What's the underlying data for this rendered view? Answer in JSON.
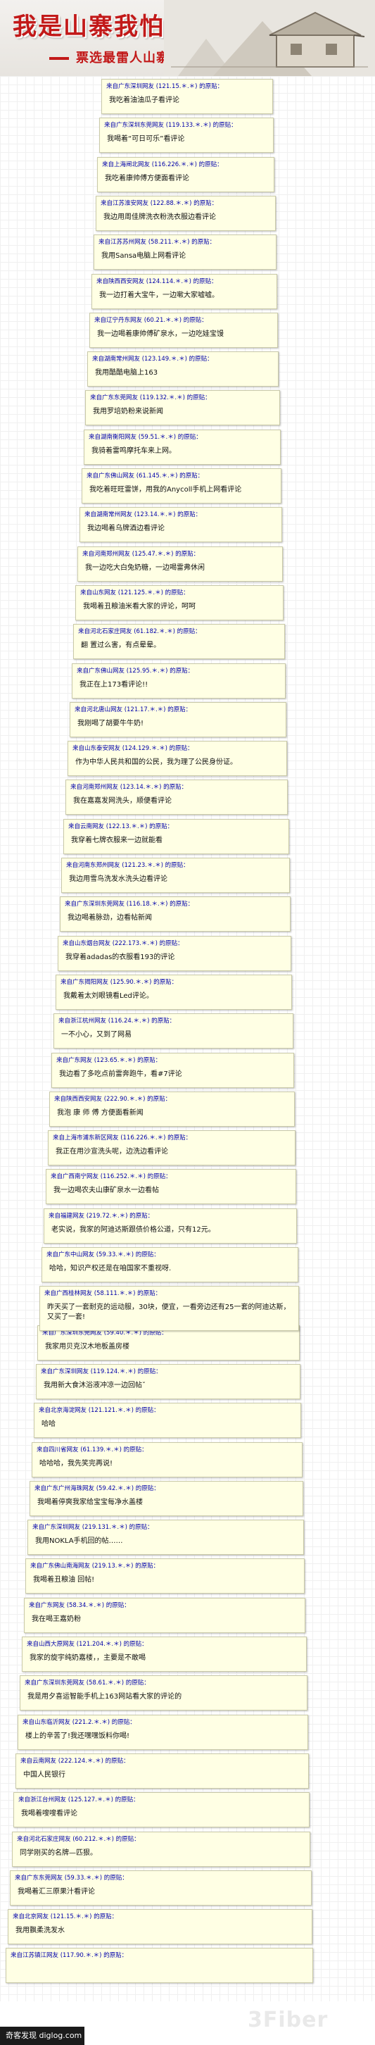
{
  "banner": {
    "title": "我是山寨我怕谁",
    "subtitle": "票选最雷人山寨作品"
  },
  "footer": {
    "site": "奇客发现 diglog.com",
    "watermark": "3Fiber"
  },
  "posts": [
    {
      "header": "来自广东深圳网友 (121.15.＊.＊) 的原贴：",
      "text": "我吃着油油瓜子看评论"
    },
    {
      "header": "来自广东深圳东莞网友 (119.133.＊.＊) 的原贴：",
      "text": "我喝着“可日可乐”看评论"
    },
    {
      "header": "来自上海闸北网友 (116.226.＊.＊) 的原贴：",
      "text": "我吃着康帅傅方便面看评论"
    },
    {
      "header": "来自江苏淮安网友 (122.88.＊.＊) 的原贴：",
      "text": "我边用周佳牌洗衣粉洗衣服边看评论"
    },
    {
      "header": "来自江苏苏州网友 (58.211.＊.＊) 的原贴：",
      "text": "我用Sansa电脑上网看评论"
    },
    {
      "header": "来自陕西西安网友 (124.114.＊.＊) 的原贴：",
      "text": "我一边打着大宝牛，一边嗽大家嘘嘘。"
    },
    {
      "header": "来自辽宁丹东网友 (60.21.＊.＊) 的原贴：",
      "text": "我一边喝着康帅傅矿泉水，一边吃娃宝馒"
    },
    {
      "header": "来自湖南常州网友 (123.149.＊.＊) 的原贴：",
      "text": "我用酷酷电脑上163"
    },
    {
      "header": "来自广东东莞网友 (119.132.＊.＊) 的原贴：",
      "text": "我用罗培奶粉来说新闻"
    },
    {
      "header": "来自湖南衡阳网友 (59.51.＊.＊) 的原贴：",
      "text": "我骑着雷鸣摩托车来上网。"
    },
    {
      "header": "来自广东佛山网友 (61.145.＊.＊) 的原贴：",
      "text": "我吃着旺旺雷饼，用我的Anycoll手机上网看评论"
    },
    {
      "header": "来自湖南常州网友 (123.14.＊.＊) 的原贴：",
      "text": "我边喝着乌牌酒边看评论"
    },
    {
      "header": "来自河南郑州网友 (125.47.＊.＊) 的原贴：",
      "text": "我一边吃大白兔奶糖，一边喝雷弗休闲"
    },
    {
      "header": "来自山东网友 (121.125.＊.＊) 的原贴：",
      "text": "我喝着丑粮油米看大家的评论，呵呵"
    },
    {
      "header": "来自河北石家庄网友 (61.182.＊.＊) 的原贴：",
      "text": "翻 置过么害，有点晕晕。"
    },
    {
      "header": "来自广东佛山网友 (125.95.＊.＊) 的原贴：",
      "text": "我正在上173看评论!!"
    },
    {
      "header": "来自河北唐山网友 (121.17.＊.＊) 的原贴：",
      "text": "我刚喝了胡要牛牛奶!"
    },
    {
      "header": "来自山东泰安网友 (124.129.＊.＊) 的原贴：",
      "text": "作为中华人民共和国的公民，我为理了公民身份证。"
    },
    {
      "header": "来自河南郑州网友 (123.14.＊.＊) 的原贴：",
      "text": "我在嘉嘉发网洗头，顺便看评论"
    },
    {
      "header": "来自云南网友 (122.13.＊.＊) 的原贴：",
      "text": "我穿着七牌衣服来一边就能看"
    },
    {
      "header": "来自河南东郑州网友 (121.23.＊.＊) 的原贴：",
      "text": "我边用雪鸟洗发水洗头边看评论"
    },
    {
      "header": "来自广东深圳东莞网友 (116.18.＊.＊) 的原贴：",
      "text": "我边喝着脉劲，边看帖新闻"
    },
    {
      "header": "来自山东烟台网友 (222.173.＊.＊) 的原贴：",
      "text": "我穿着adadas的衣服看193的评论"
    },
    {
      "header": "来自广东揭阳网友 (125.90.＊.＊) 的原贴：",
      "text": "我戴着太刘眼镜看Led评论。"
    },
    {
      "header": "来自浙江杭州网友 (116.24.＊.＊) 的原贴：",
      "text": "一不小心，又到了网易"
    },
    {
      "header": "来自广东网友 (123.65.＊.＊) 的原贴：",
      "text": "我边看了多吃点前雷奔跑牛，看#7评论"
    },
    {
      "header": "来自陕西西安网友 (222.90.＊.＊) 的原贴：",
      "text": "我泡 康 师 傅 方便面看新闻"
    },
    {
      "header": "来自上海市浦东新区网友 (116.226.＊.＊) 的原贴：",
      "text": "我正在用沙宣洗头呢，边洗边看评论"
    },
    {
      "header": "来自广西南宁网友 (116.252.＊.＊) 的原贴：",
      "text": "我一边喝农夫山康矿泉水一边看帖"
    },
    {
      "header": "来自福建网友 (219.72.＊.＊) 的原贴：",
      "text": "老实说，我家的阿迪达斯跟债价格公道，只有12元。"
    },
    {
      "header": "来自广东中山网友 (59.33.＊.＊) 的原贴：",
      "text": "哈哈，知识产权还是在咱国家不重视呀."
    },
    {
      "header": "来自广西桂林网友 (58.111.＊.＊) 的原贴：",
      "text": "昨天买了一套耐克的运动服，30块，便宜，一看旁边还有25一套的阿迪达斯，又买了一套!"
    },
    {
      "header": "来自广东深圳东莞网友 (59.40.＊.＊) 的原贴：",
      "text": "我家用贝克汉木地板盖房楼"
    },
    {
      "header": "来自广东深圳网友 (119.124.＊.＊) 的原贴：",
      "text": "我用新大食沐浴液冲凉一边回帖ˇ"
    },
    {
      "header": "来自北京海淀网友 (121.121.＊.＊) 的原贴：",
      "text": "哈哈"
    },
    {
      "header": "来自四川省网友 (61.139.＊.＊) 的原贴：",
      "text": "哈哈哈，我先笑完再说!"
    },
    {
      "header": "来自广东广州海珠网友 (59.42.＊.＊) 的原贴：",
      "text": "我喝着停爽我家给宝宝每净水盖楼"
    },
    {
      "header": "来自广东深圳网友 (219.131.＊.＊) 的原贴：",
      "text": "我用NOKLA手机回的帖……"
    },
    {
      "header": "来自广东佛山南海网友 (219.13.＊.＊) 的原贴：",
      "text": "我喝着丑粮油 回帖!"
    },
    {
      "header": "来自广东网友 (58.34.＊.＊) 的原贴：",
      "text": "我在喝王嘉奶粉"
    },
    {
      "header": "来自山西大原网友 (121.204.＊.＊) 的原贴：",
      "text": "我家的旋宇纯奶嘉楼，，主要是不敢喝"
    },
    {
      "header": "来自广东深圳东莞网友 (58.61.＊.＊) 的原贴：",
      "text": "我是用夕喜运智能手机上163网站看大家的评论的"
    },
    {
      "header": "来自山东临沂网友 (221.2.＊.＊) 的原贴：",
      "text": "楼上的辛苦了!我还嘿嘿饭料你喝!"
    },
    {
      "header": "来自云南网友 (222.124.＊.＊) 的原贴：",
      "text": "中国人民银行"
    },
    {
      "header": "来自浙江台州网友 (125.127.＊.＊) 的原贴：",
      "text": "我喝着嗖嗖看评论"
    },
    {
      "header": "来自河北石家庄网友 (60.212.＊.＊) 的原贴：",
      "text": "同学刚买的名牌—匹狠。"
    },
    {
      "header": "来自广东东莞网友 (59.33.＊.＊) 的原贴：",
      "text": "我喝着汇三原果汁看评论"
    },
    {
      "header": "来自北京网友 (121.15.＊.＊) 的原贴：",
      "text": "我用飘柔洗发水"
    },
    {
      "header": "来自江苏镇江网友 (117.90.＊.＊) 的原贴：",
      "text": ""
    }
  ]
}
